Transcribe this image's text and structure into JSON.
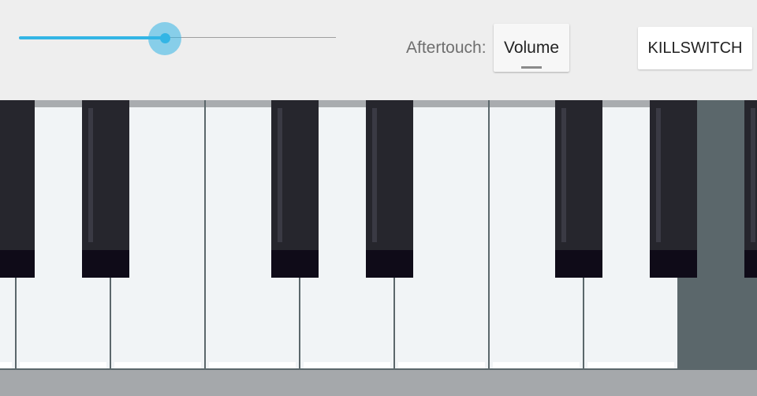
{
  "toolbar": {
    "volume_slider": {
      "value_fraction": 0.46,
      "accent_color": "#33b5e5"
    },
    "aftertouch_label": "Aftertouch:",
    "aftertouch_mode": "Volume",
    "killswitch_label": "KILLSWITCH"
  },
  "keyboard": {
    "white_keys": 8,
    "black_keys": 7
  }
}
